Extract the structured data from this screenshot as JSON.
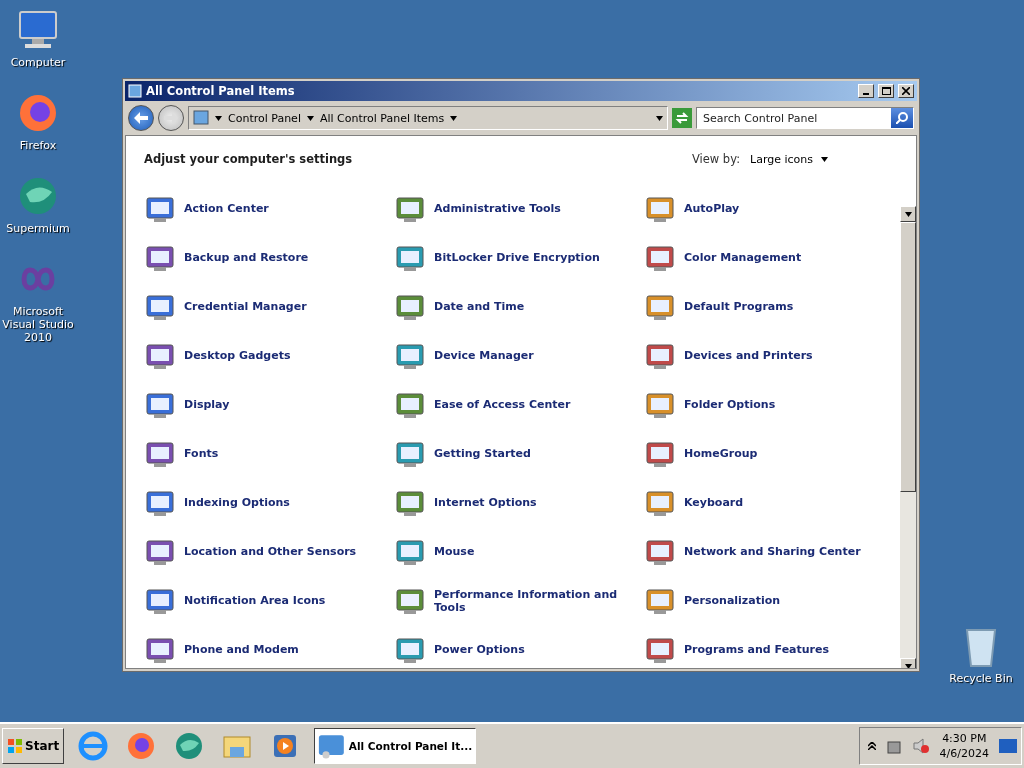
{
  "desktop_icons": [
    {
      "label": "Computer",
      "kind": "computer"
    },
    {
      "label": "Firefox",
      "kind": "firefox"
    },
    {
      "label": "Supermium",
      "kind": "supermium"
    },
    {
      "label": "Microsoft Visual Studio 2010",
      "kind": "vs"
    }
  ],
  "recycle_bin": {
    "label": "Recycle Bin"
  },
  "window": {
    "title": "All Control Panel Items",
    "breadcrumb": [
      "Control Panel",
      "All Control Panel Items"
    ],
    "search": {
      "placeholder": "Search Control Panel"
    },
    "heading": "Adjust your computer's settings",
    "view_by": {
      "label": "View by:",
      "value": "Large icons"
    },
    "items": [
      {
        "label": "Action Center"
      },
      {
        "label": "Administrative Tools"
      },
      {
        "label": "AutoPlay"
      },
      {
        "label": "Backup and Restore"
      },
      {
        "label": "BitLocker Drive Encryption"
      },
      {
        "label": "Color Management"
      },
      {
        "label": "Credential Manager"
      },
      {
        "label": "Date and Time"
      },
      {
        "label": "Default Programs"
      },
      {
        "label": "Desktop Gadgets"
      },
      {
        "label": "Device Manager"
      },
      {
        "label": "Devices and Printers"
      },
      {
        "label": "Display"
      },
      {
        "label": "Ease of Access Center"
      },
      {
        "label": "Folder Options"
      },
      {
        "label": "Fonts"
      },
      {
        "label": "Getting Started"
      },
      {
        "label": "HomeGroup"
      },
      {
        "label": "Indexing Options"
      },
      {
        "label": "Internet Options"
      },
      {
        "label": "Keyboard"
      },
      {
        "label": "Location and Other Sensors"
      },
      {
        "label": "Mouse"
      },
      {
        "label": "Network and Sharing Center"
      },
      {
        "label": "Notification Area Icons"
      },
      {
        "label": "Performance Information and Tools"
      },
      {
        "label": "Personalization"
      },
      {
        "label": "Phone and Modem"
      },
      {
        "label": "Power Options"
      },
      {
        "label": "Programs and Features"
      }
    ]
  },
  "taskbar": {
    "start": "Start",
    "pinned": [
      {
        "kind": "ie"
      },
      {
        "kind": "firefox"
      },
      {
        "kind": "supermium"
      },
      {
        "kind": "explorer"
      },
      {
        "kind": "media"
      }
    ],
    "task": {
      "label": "All Control Panel It...",
      "selected": true
    },
    "clock": {
      "time": "4:30 PM",
      "date": "4/6/2024"
    }
  }
}
